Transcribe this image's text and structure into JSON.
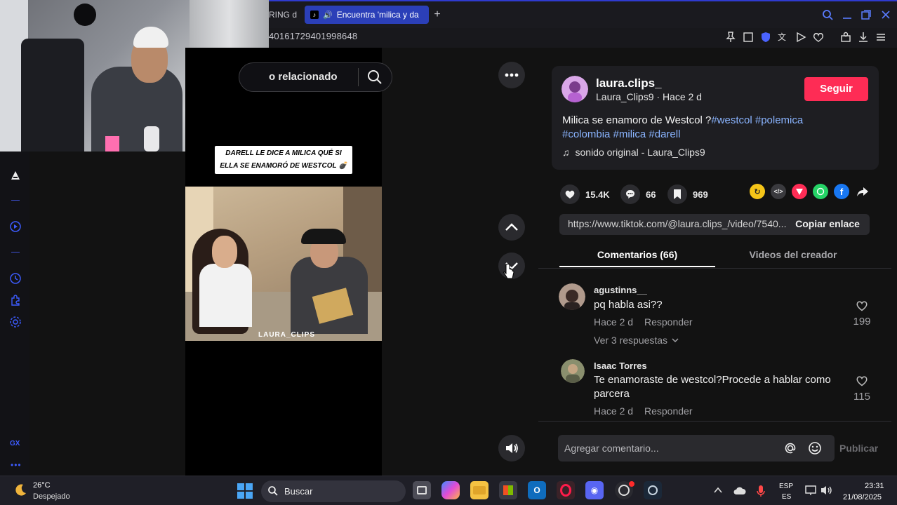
{
  "browser": {
    "partial_tab_label": "RING d",
    "active_tab_label": "Encuentra 'milica y da",
    "address_fragment": "40161729401998648"
  },
  "search": {
    "text": "o relacionado"
  },
  "video": {
    "caption": "DARELL LE DICE A MILICA QUÉ SI ELLA SE ENAMORÓ DE WESTCOL 💣",
    "watermark": "LAURA_CLIPS"
  },
  "post": {
    "username": "laura.clips_",
    "handle_time": "Laura_Clips9 · Hace 2 d",
    "follow_label": "Seguir",
    "description_plain": "Milica se enamoro de Westcol ?",
    "hashtags_line1": "#westcol #polemica",
    "hashtags_line2": "#colombia #milica #darell",
    "sound": "sonido original - Laura_Clips9",
    "likes": "15.4K",
    "comments": "66",
    "saves": "969",
    "link": "https://www.tiktok.com/@laura.clips_/video/7540...",
    "copy_label": "Copiar enlace"
  },
  "tabs": {
    "comments": "Comentarios (66)",
    "creator_videos": "Videos del creador"
  },
  "comments": [
    {
      "name": "agustinns__",
      "text": "pq habla asi??",
      "time": "Hace 2 d",
      "reply": "Responder",
      "likes": "199",
      "more_replies": "Ver 3 respuestas"
    },
    {
      "name": "Isaac Torres",
      "text_line1": "Te enamoraste de westcol?Procede a hablar como",
      "text_line2": "parcera",
      "time": "Hace 2 d",
      "reply": "Responder",
      "likes": "115"
    }
  ],
  "comment_box": {
    "placeholder": "Agregar comentario...",
    "publish": "Publicar"
  },
  "taskbar": {
    "temp": "26°C",
    "weather": "Despejado",
    "search": "Buscar",
    "lang1": "ESP",
    "lang2": "ES",
    "time": "23:31",
    "date": "21/08/2025"
  },
  "sidebar": {
    "gx_label": "GX"
  },
  "colors": {
    "accent_red": "#fe2c55",
    "hashtag_blue": "#8ab4ff",
    "tab_blue": "#2b3fb8"
  }
}
